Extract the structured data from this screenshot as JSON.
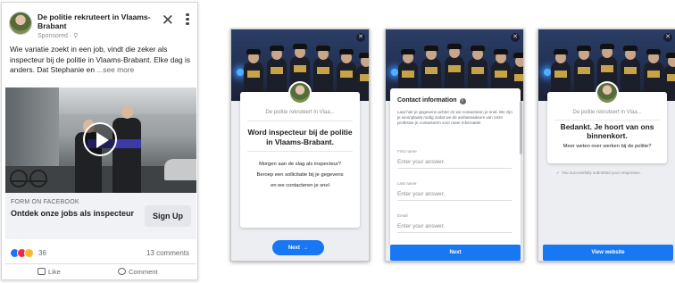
{
  "ad": {
    "page_name": "De politie rekruteert in Vlaams-Brabant",
    "sponsored": "Sponsored · ⚲",
    "body": "Wie variatie zoekt in een job, vindt die zeker als inspecteur bij de politie in Vlaams-Brabant. Elke dag is anders. Dat Stephanie en",
    "see_more": "...see more",
    "form_label": "FORM ON FACEBOOK",
    "form_title": "Ontdek onze jobs als inspecteur",
    "cta": "Sign Up",
    "reaction_count": "36",
    "comments": "13 comments",
    "like": "Like",
    "comment": "Comment"
  },
  "screen1": {
    "page": "De politie rekruteert in Vlaa...",
    "title": "Word inspecteur bij de politie in Vlaams-Brabant.",
    "line1": "Morgen aan de slag als inspecteur?",
    "line2": "Beroep een sollicitatie bij je gegevens",
    "line3": "en we contacteren je snel",
    "next": "Next"
  },
  "screen2": {
    "heading": "Contact information",
    "info_icon": "i",
    "description": "Laat hier je gegevens achter en we contacteren je snel. We zijn je woonplaats nodig zodat we de ambassadeurs van onze professie je contacteren voor meer informatie!",
    "field1_label": "First name",
    "field2_label": "Last name",
    "field3_label": "Email",
    "placeholder": "Enter your answer.",
    "button": "Next"
  },
  "screen3": {
    "page": "De politie rekruteert in Vlaa...",
    "title": "Bedankt. Je hoort van ons binnenkort.",
    "subtitle": "Meer weten over werken bij de politie?",
    "success": "You successfully submitted your responses.",
    "button": "View website"
  },
  "colors": {
    "facebook_blue": "#1877f2",
    "cta_bar": "#f0f2f5",
    "police_uniform": "#1c1f29"
  },
  "icons": {
    "close": "close-icon",
    "more": "more-vertical-icon",
    "play": "play-icon",
    "like": "thumbs-up-icon",
    "comment": "comment-icon",
    "info": "info-icon"
  }
}
